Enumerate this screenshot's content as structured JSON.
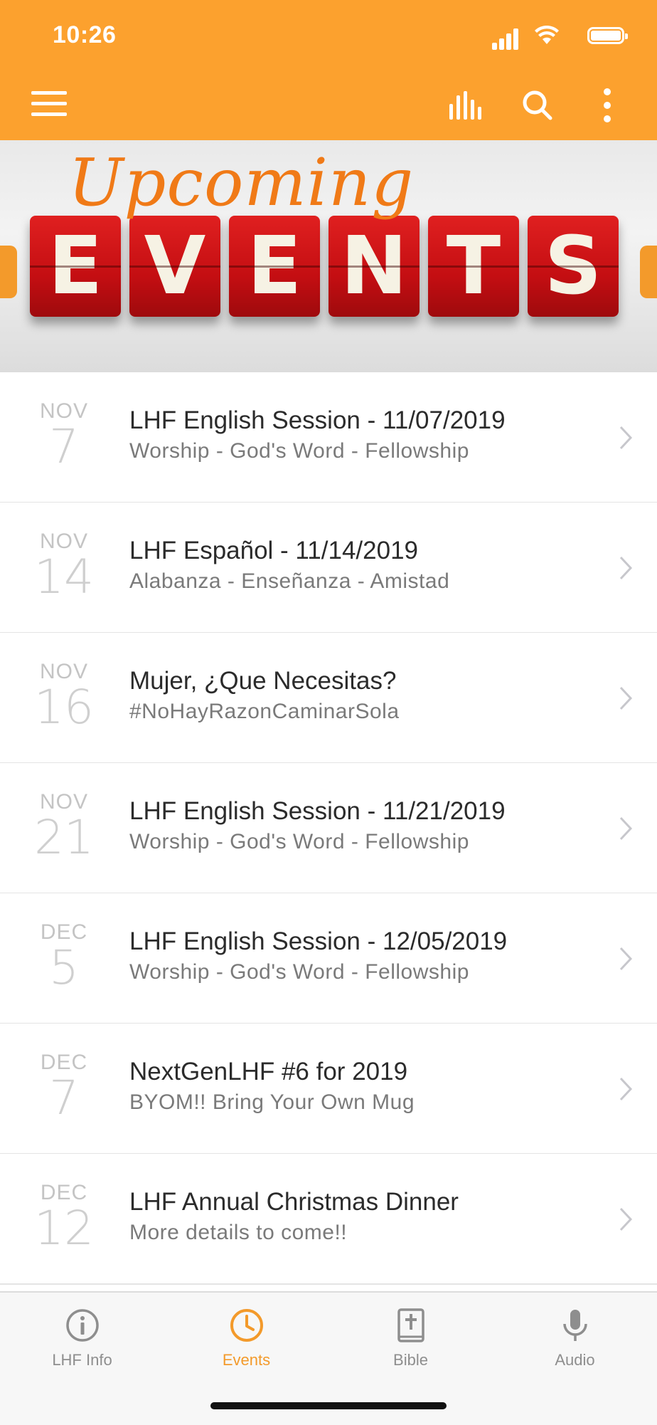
{
  "status_bar": {
    "time": "10:26"
  },
  "header": {
    "menu_icon": "hamburger-menu-icon",
    "actions": [
      "equalizer-icon",
      "search-icon",
      "more-vertical-icon"
    ]
  },
  "banner": {
    "script_text": "Upcoming",
    "tiles": [
      "E",
      "V",
      "E",
      "N",
      "T",
      "S"
    ]
  },
  "events": [
    {
      "month": "NOV",
      "day": "7",
      "title": "LHF English Session - 11/07/2019",
      "subtitle": "Worship - God's Word - Fellowship"
    },
    {
      "month": "NOV",
      "day": "14",
      "title": "LHF Español - 11/14/2019",
      "subtitle": "Alabanza - Enseñanza - Amistad"
    },
    {
      "month": "NOV",
      "day": "16",
      "title": "Mujer, ¿Que Necesitas?",
      "subtitle": "#NoHayRazonCaminarSola"
    },
    {
      "month": "NOV",
      "day": "21",
      "title": "LHF English Session - 11/21/2019",
      "subtitle": "Worship - God's Word - Fellowship"
    },
    {
      "month": "DEC",
      "day": "5",
      "title": "LHF English Session - 12/05/2019",
      "subtitle": "Worship - God's Word - Fellowship"
    },
    {
      "month": "DEC",
      "day": "7",
      "title": "NextGenLHF #6 for 2019",
      "subtitle": "BYOM!! Bring Your Own Mug"
    },
    {
      "month": "DEC",
      "day": "12",
      "title": "LHF Annual Christmas Dinner",
      "subtitle": "More details to come!!"
    }
  ],
  "tabs": [
    {
      "label": "LHF Info",
      "icon": "info-icon",
      "active": false
    },
    {
      "label": "Events",
      "icon": "clock-icon",
      "active": true
    },
    {
      "label": "Bible",
      "icon": "bible-icon",
      "active": false
    },
    {
      "label": "Audio",
      "icon": "microphone-icon",
      "active": false
    }
  ],
  "colors": {
    "accent": "#FCA12E",
    "active_tab": "#F39A2B",
    "tile_red": "#C40E12"
  }
}
